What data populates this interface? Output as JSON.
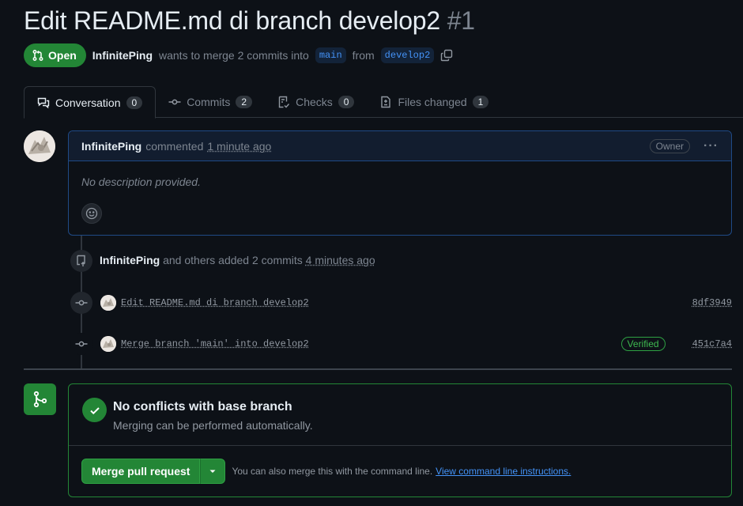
{
  "pr": {
    "title": "Edit README.md di branch develop2",
    "number": "#1",
    "state": "Open",
    "author": "InfinitePing",
    "merge_text_pre": "wants to merge 2 commits into",
    "base_branch": "main",
    "from_text": "from",
    "head_branch": "develop2"
  },
  "tabs": [
    {
      "label": "Conversation",
      "count": "0"
    },
    {
      "label": "Commits",
      "count": "2"
    },
    {
      "label": "Checks",
      "count": "0"
    },
    {
      "label": "Files changed",
      "count": "1"
    }
  ],
  "comment": {
    "author": "InfinitePing",
    "action": "commented",
    "time": "1 minute ago",
    "role": "Owner",
    "menu": "···",
    "body": "No description provided."
  },
  "push_event": {
    "author": "InfinitePing",
    "text": "and others added 2 commits",
    "time": "4 minutes ago"
  },
  "commits": [
    {
      "message": "Edit README.md di branch develop2",
      "sha": "8df3949",
      "verified": ""
    },
    {
      "message": "Merge branch 'main' into develop2",
      "sha": "451c7a4",
      "verified": "Verified"
    }
  ],
  "merge": {
    "title": "No conflicts with base branch",
    "subtitle": "Merging can be performed automatically.",
    "button": "Merge pull request",
    "note": "You can also merge this with the command line.",
    "link": "View command line instructions."
  },
  "colors": {
    "open_green": "#238636",
    "link_blue": "#4493f8",
    "bg": "#0d1117",
    "muted": "#7d8590"
  }
}
